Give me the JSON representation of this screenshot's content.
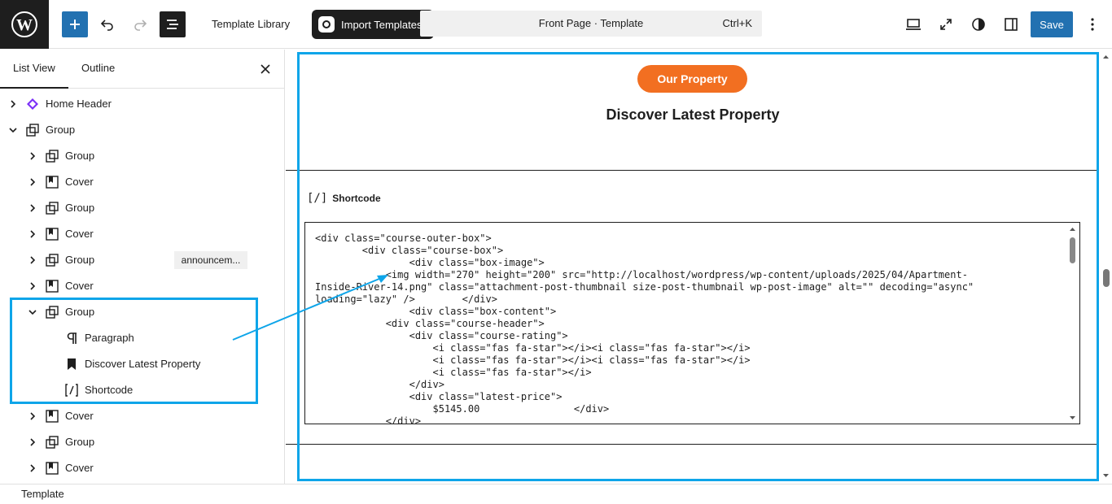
{
  "toolbar": {
    "template_library": "Template Library",
    "import_templates": "Import Templates",
    "command_title": "Front Page · Template",
    "command_shortcut": "Ctrl+K",
    "save_label": "Save"
  },
  "sidebar": {
    "tabs": [
      {
        "label": "List View"
      },
      {
        "label": "Outline"
      }
    ],
    "rows": [
      {
        "label": "Home Header",
        "icon": "template-part-icon"
      },
      {
        "label": "Group",
        "icon": "group-icon"
      },
      {
        "label": "Group",
        "icon": "group-icon"
      },
      {
        "label": "Cover",
        "icon": "cover-icon"
      },
      {
        "label": "Group",
        "icon": "group-icon"
      },
      {
        "label": "Cover",
        "icon": "cover-icon"
      },
      {
        "label": "Group",
        "icon": "group-icon",
        "badge": "announcem..."
      },
      {
        "label": "Cover",
        "icon": "cover-icon"
      },
      {
        "label": "Group",
        "icon": "group-icon"
      },
      {
        "label": "Paragraph",
        "icon": "paragraph-icon"
      },
      {
        "label": "Discover Latest Property",
        "icon": "heading-bookmark-icon"
      },
      {
        "label": "Shortcode",
        "icon": "shortcode-icon"
      },
      {
        "label": "Cover",
        "icon": "cover-icon"
      },
      {
        "label": "Group",
        "icon": "group-icon"
      },
      {
        "label": "Cover",
        "icon": "cover-icon"
      }
    ]
  },
  "canvas": {
    "pill_label": "Our Property",
    "heading": "Discover Latest Property",
    "shortcode_label": "Shortcode",
    "shortcode_icon": "[/]",
    "code": "<div class=\"course-outer-box\">\n        <div class=\"course-box\">\n                <div class=\"box-image\">\n            <img width=\"270\" height=\"200\" src=\"http://localhost/wordpress/wp-content/uploads/2025/04/Apartment-\nInside-River-14.png\" class=\"attachment-post-thumbnail size-post-thumbnail wp-post-image\" alt=\"\" decoding=\"async\"\nloading=\"lazy\" />        </div>\n                <div class=\"box-content\">\n            <div class=\"course-header\">\n                <div class=\"course-rating\">\n                    <i class=\"fas fa-star\"></i><i class=\"fas fa-star\"></i>\n                    <i class=\"fas fa-star\"></i><i class=\"fas fa-star\"></i>\n                    <i class=\"fas fa-star\"></i>\n                </div>\n                <div class=\"latest-price\">\n                    $5145.00                </div>\n            </div>"
  },
  "footer": {
    "breadcrumb": "Template"
  },
  "colors": {
    "accent": "#2271b1",
    "highlight": "#0ea5e9",
    "pill": "#f26f21"
  }
}
